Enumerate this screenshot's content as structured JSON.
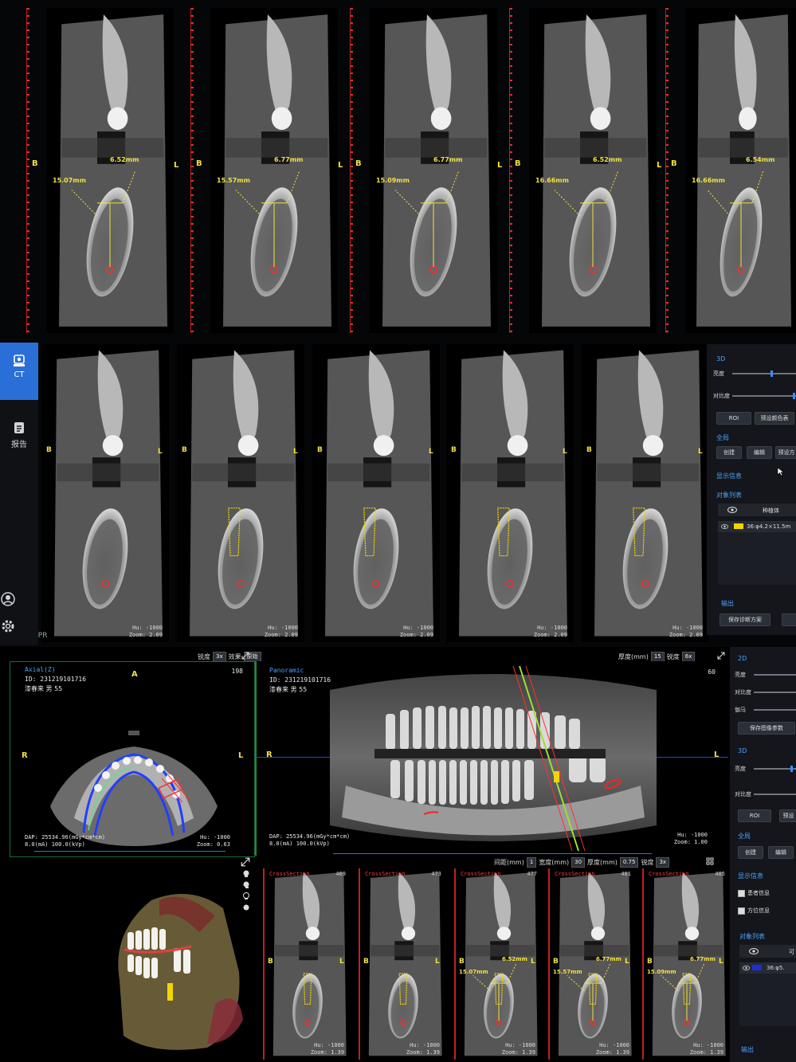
{
  "top_rows": {
    "row1": [
      {
        "left": "B",
        "right": "L",
        "m_left": "15.07mm",
        "m_top": "6.52mm"
      },
      {
        "left": "B",
        "right": "L",
        "m_left": "15.57mm",
        "m_top": "6.77mm"
      },
      {
        "left": "B",
        "right": "L",
        "m_left": "15.09mm",
        "m_top": "6.77mm"
      },
      {
        "left": "B",
        "right": "L",
        "m_left": "16.66mm",
        "m_top": "6.52mm"
      },
      {
        "left": "B",
        "right": "",
        "m_left": "16.66mm",
        "m_top": "6.54mm"
      }
    ],
    "row2": [
      {
        "left": "B",
        "right": "L",
        "hu": "Hu: -1000",
        "zoom": "Zoom: 2.09"
      },
      {
        "left": "B",
        "right": "L",
        "hu": "Hu: -1000",
        "zoom": "Zoom: 2.09"
      },
      {
        "left": "B",
        "right": "L",
        "hu": "Hu: -1000",
        "zoom": "Zoom: 2.09"
      },
      {
        "left": "B",
        "right": "L",
        "hu": "Hu: -1000",
        "zoom": "Zoom: 2.09"
      },
      {
        "left": "B",
        "right": "L",
        "hu": "Hu: -1000",
        "zoom": "Zoom: 2.09"
      }
    ],
    "mpr_label": "MPR"
  },
  "sidebar": {
    "items": [
      {
        "label": "CT",
        "icon": "ct-scan-icon",
        "active": true
      },
      {
        "label": "报告",
        "icon": "report-icon",
        "active": false
      }
    ],
    "bottom_icons": [
      "user-icon",
      "settings-icon"
    ]
  },
  "right_panel_top": {
    "section_3d": "3D",
    "brightness": "亮度",
    "contrast": "对比度",
    "roi": "ROI",
    "preset_color": "预设颜色表",
    "global": "全局",
    "create": "创建",
    "edit": "编辑",
    "preset": "预设方",
    "display_info": "显示信息",
    "object_list": "对象列表",
    "implant_header": "种植体",
    "implant_item": "36:φ4.2×11.5m",
    "output": "输出",
    "save_plan": "保存诊断方案"
  },
  "toolbar_left": {
    "sharpness": "锐度",
    "sharp_val": "3x",
    "effect": "效果",
    "effect_val": "原始"
  },
  "toolbar_mid": {
    "thickness": "厚度(mm)",
    "thick_val": "15",
    "sharpness": "锐度",
    "sharp_val": "6x"
  },
  "axial": {
    "title": "Axial(Z)",
    "id": "ID: 231219101716",
    "patient": "漆春来 男 55",
    "slice": "198",
    "a": "A",
    "p": "P",
    "r": "R",
    "l": "L",
    "dap": "DAP: 25534.96(mGy*cm*cm)",
    "kv": "8.0(mA) 100.0(kVp)",
    "hu": "Hu: -1000",
    "zoom": "Zoom: 0.63"
  },
  "panoramic": {
    "title": "Panoramic",
    "id": "ID: 231219101716",
    "patient": "漆春来 男 55",
    "slice": "60",
    "r": "R",
    "l": "L",
    "dap": "DAP: 25534.96(mGy*cm*cm)",
    "kv": "8.0(mA) 100.0(kVp)",
    "hu": "Hu: -1000",
    "zoom": "Zoom: 1.00"
  },
  "right_panel_bottom": {
    "section_2d": "2D",
    "brightness": "亮度",
    "contrast": "对比度",
    "gamma": "伽马",
    "save_params": "保存图像参数",
    "section_3d": "3D",
    "brightness3d": "亮度",
    "contrast3d": "对比度",
    "roi": "ROI",
    "preset": "预设",
    "global": "全局",
    "create": "创建",
    "edit": "编辑",
    "display_info": "显示信息",
    "patient_info": "患者信息",
    "orientation_info": "方位信息",
    "object_list": "对象列表",
    "implant_item": "36:φ5.",
    "output": "输出",
    "col_vis": "可"
  },
  "cross_toolbar": {
    "interval": "间距(mm)",
    "interval_val": "1",
    "width": "宽度(mm)",
    "width_val": "30",
    "thickness": "厚度(mm)",
    "thick_val": "0.75",
    "sharpness": "锐度",
    "sharp_val": "3x"
  },
  "cross_sections": [
    {
      "label": "CrossSection",
      "num": "469",
      "left": "B",
      "right": "L",
      "m_left": "",
      "m_top": "",
      "hu": "Hu: -1000",
      "zoom": "Zoom: 1.39"
    },
    {
      "label": "CrossSection",
      "num": "473",
      "left": "B",
      "right": "L",
      "m_left": "",
      "m_top": "",
      "hu": "Hu: -1000",
      "zoom": "Zoom: 1.39"
    },
    {
      "label": "CrossSection",
      "num": "477",
      "left": "B",
      "right": "L",
      "m_left": "15.07mm",
      "m_top": "6.52mm",
      "hu": "Hu: -1000",
      "zoom": "Zoom: 1.39"
    },
    {
      "label": "CrossSection",
      "num": "481",
      "left": "B",
      "right": "L",
      "m_left": "15.57mm",
      "m_top": "6.77mm",
      "hu": "Hu: -1000",
      "zoom": "Zoom: 1.39"
    },
    {
      "label": "CrossSection",
      "num": "485",
      "left": "B",
      "right": "L",
      "m_left": "15.09mm",
      "m_top": "6.77mm",
      "hu": "Hu: -1000",
      "zoom": "Zoom: 1.39"
    }
  ]
}
